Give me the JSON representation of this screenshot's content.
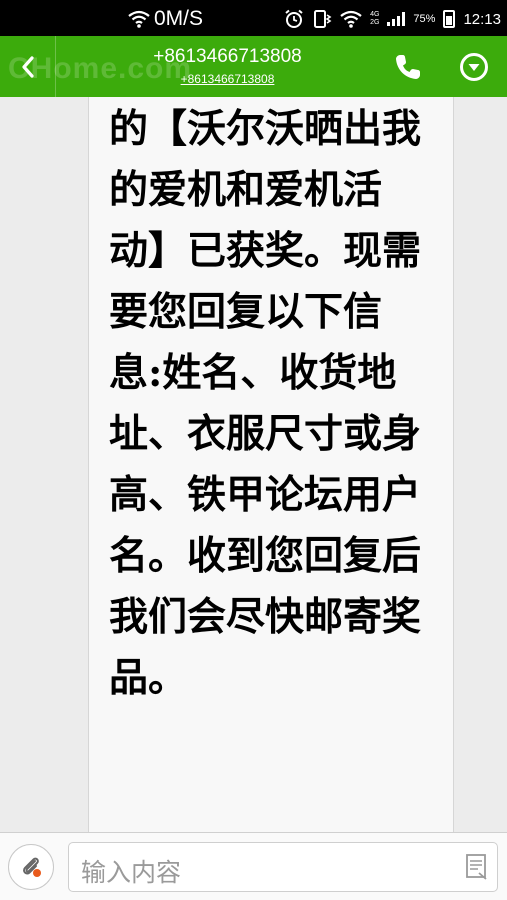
{
  "status_bar": {
    "net_speed": "0M/S",
    "network_4g": "4G",
    "network_2g": "2G",
    "battery": "75%",
    "battery_level": 0.75,
    "time": "12:13",
    "icons": [
      "wifi-speed-icon",
      "alarm-icon",
      "vibrate-icon",
      "wifi-icon",
      "signal-icon",
      "battery-icon"
    ]
  },
  "header": {
    "watermark": "CHome.com",
    "contact_number": "+8613466713808",
    "contact_sub": "+8613466713808",
    "accent_color": "#3cab0c"
  },
  "message": {
    "text": "的【沃尔沃晒出我的爱机和爱机活动】已获奖。现需要您回复以下信息:姓名、收货地址、衣服尺寸或身高、铁甲论坛用户名。收到您回复后我们会尽快邮寄奖品。"
  },
  "input_bar": {
    "placeholder": "输入内容"
  }
}
